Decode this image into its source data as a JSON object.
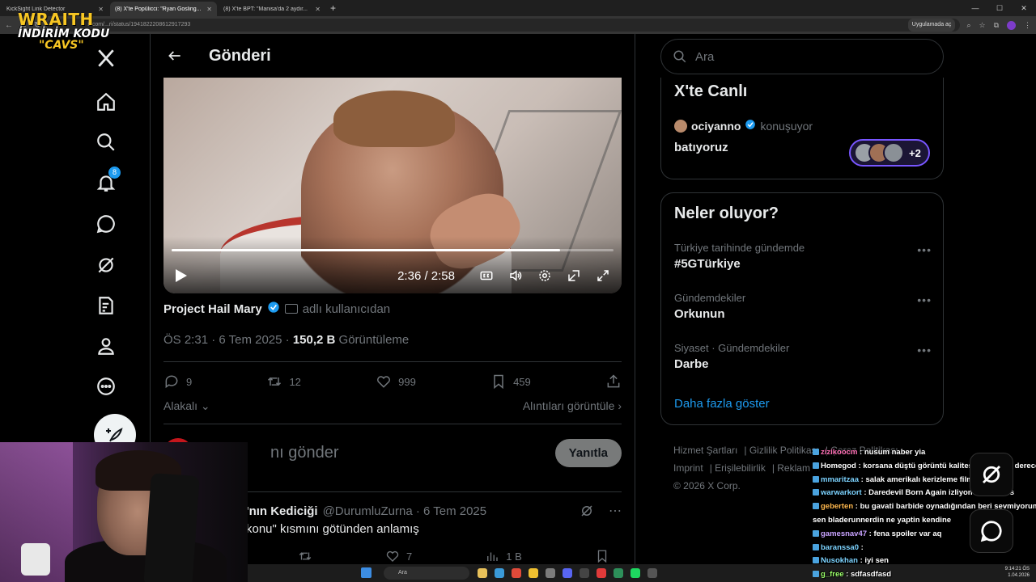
{
  "browser": {
    "tabs": [
      {
        "label": "KickSight Link Detector",
        "active": false
      },
      {
        "label": "(8) X'te Popülicci: \"Ryan Gosling...",
        "active": true
      },
      {
        "label": "(8) X'te BPT: \"Manisa'da 2 aydır...",
        "active": false
      }
    ],
    "url": "x.com/...ri/status/1941822208612917293",
    "app_pill": "Uygulamada aç"
  },
  "overlay": {
    "brand": "WRAITH",
    "promo": "İNDİRİM KODU",
    "code": "\"CAVS\""
  },
  "nav": {
    "notifications_badge": "8"
  },
  "post": {
    "header_title": "Gönderi",
    "video_time": "2:36 / 2:58",
    "video_progress": 0.88,
    "author": "Project Hail Mary",
    "author_suffix": "adlı kullanıcıdan",
    "timestamp": "ÖS 2:31 · 6 Tem 2025 ·",
    "views": "150,2 B",
    "views_label": "Görüntüleme",
    "replies": "9",
    "reposts": "12",
    "likes": "999",
    "bookmarks": "459",
    "relevance": "Alakalı",
    "view_quotes": "Alıntıları görüntüle",
    "reply_placeholder": "nı gönder",
    "reply_button": "Yanıtla"
  },
  "reply_tweet": {
    "name": "'nın Kediciği",
    "handle": "@DurumluZurna · 6 Tem 2025",
    "text": "konu\" kısmını götünden anlamış",
    "reposts": "",
    "likes": "7",
    "views": "1 B"
  },
  "sidebar": {
    "search_placeholder": "Ara",
    "live": {
      "title": "X'te Canlı",
      "user": "ociyanno",
      "status": "konuşuyor",
      "topic": "batıyoruz",
      "extra": "+2"
    },
    "trends_title": "Neler oluyor?",
    "trends": [
      {
        "context": "Türkiye tarihinde gündemde",
        "name": "#5GTürkiye"
      },
      {
        "context": "Gündemdekiler",
        "name": "Orkunun"
      },
      {
        "context": "Siyaset · Gündemdekiler",
        "name": "Darbe"
      }
    ],
    "show_more": "Daha fazla göster",
    "footer": {
      "links": [
        "Hizmet Şartları",
        "Gizlilik Politikası",
        "Çerez Politikası",
        "Imprint",
        "Erişilebilirlik",
        "Reklam"
      ],
      "copyright": "© 2026 X Corp."
    }
  },
  "chat": [
    {
      "user": "zizikoocm",
      "color": "#ff6fb5",
      "text": ": nusum naber yia"
    },
    {
      "user": "Homegod",
      "color": "#ffffff",
      "text": ": korsana düştü görüntü kalitesi izlenebilir derecede"
    },
    {
      "user": "mmaritzaa",
      "color": "#7cd3ff",
      "text": ": salak amerikalı kerizleme filmi"
    },
    {
      "user": "warwarkort",
      "color": "#7cd3ff",
      "text": ": Daredevil Born Again izliyon mu @Cavs"
    },
    {
      "user": "geberten",
      "color": "#ffb84d",
      "text": ": bu gavati barbide oynadığından beri sevmiyorum"
    },
    {
      "user": "",
      "color": "#ffffff",
      "text": "sen bladerunnerdin ne yaptin kendine"
    },
    {
      "user": "gamesnav47",
      "color": "#c8a2ff",
      "text": ": fena spoiler var aq"
    },
    {
      "user": "baranssa0",
      "color": "#7cd3ff",
      "text": ":"
    },
    {
      "user": "Nusokhan",
      "color": "#7cd3ff",
      "text": ": iyi sen"
    },
    {
      "user": "g_free",
      "color": "#9cff6b",
      "text": ": sdfasdfasd"
    }
  ],
  "taskbar": {
    "search": "Ara",
    "time": "9:14:21 ÖS",
    "date": "1.04.2026"
  }
}
